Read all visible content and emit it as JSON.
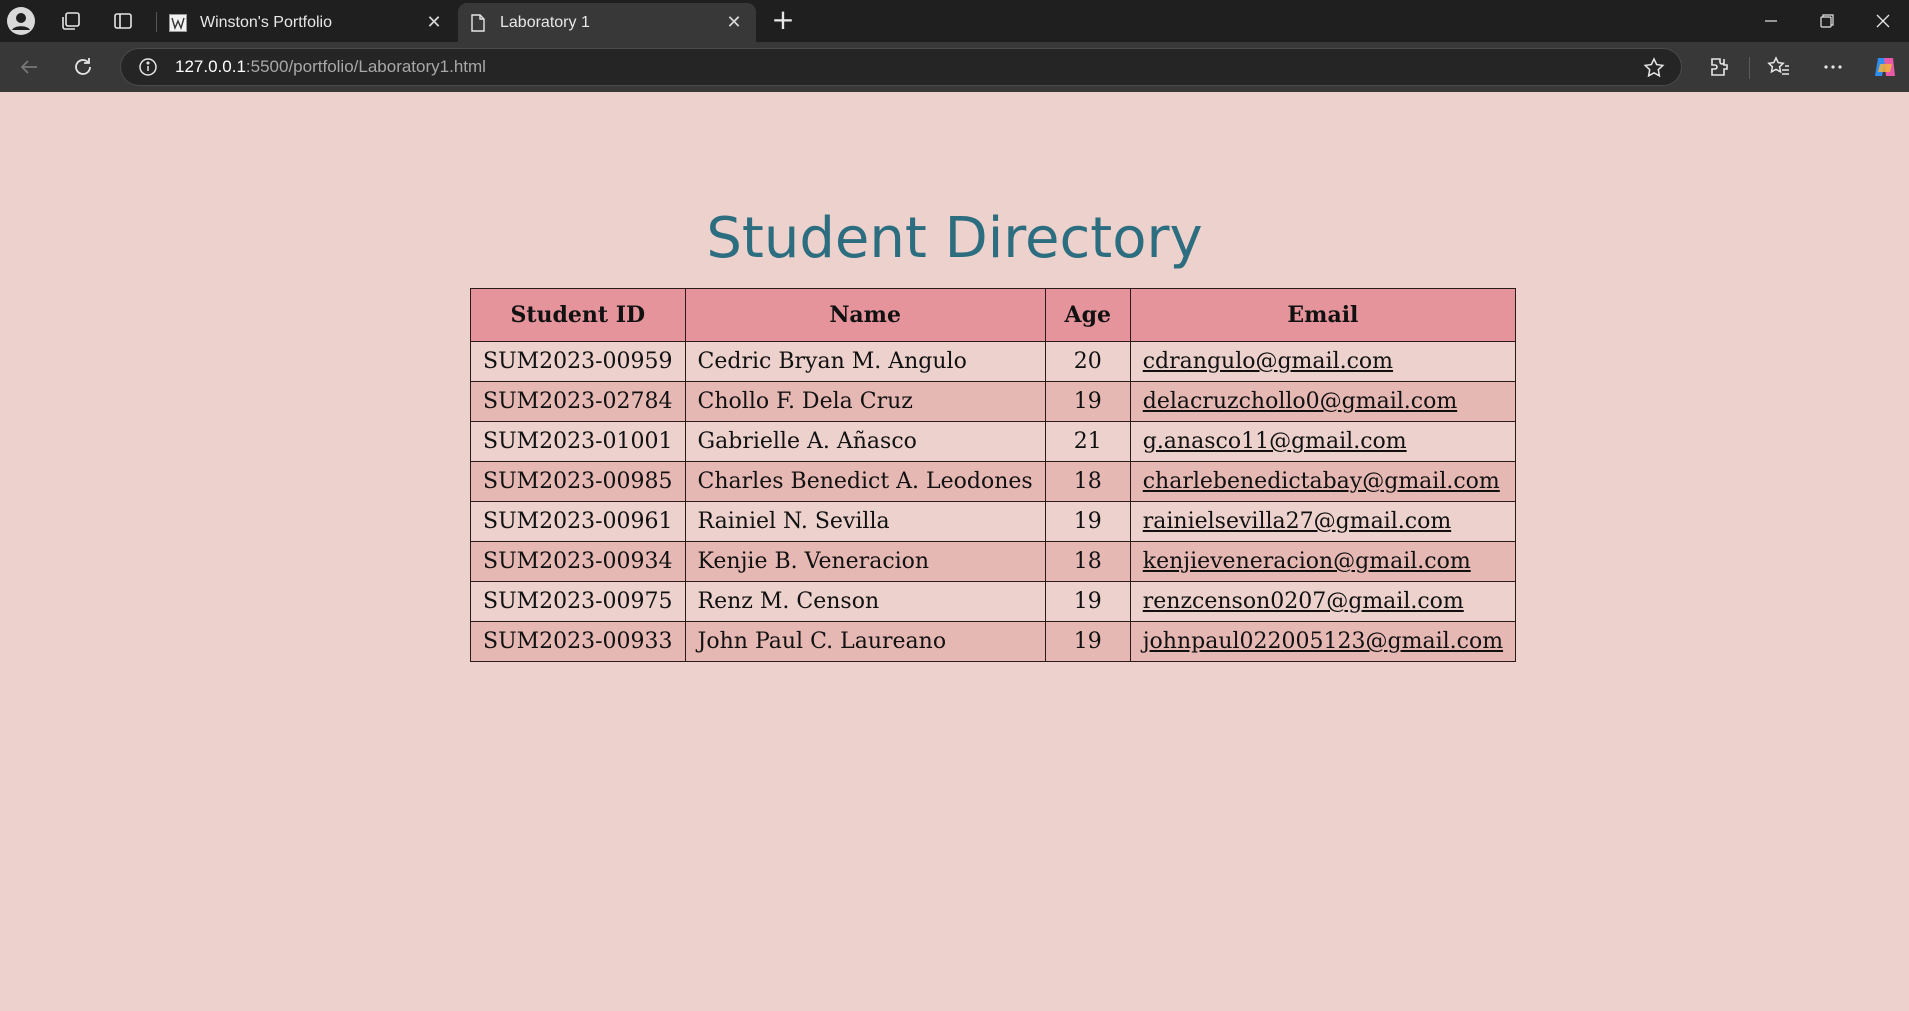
{
  "browser": {
    "tabs": [
      {
        "label": "Winston's Portfolio",
        "active": false
      },
      {
        "label": "Laboratory 1",
        "active": true
      }
    ],
    "address": {
      "host": "127.0.0.1",
      "path": ":5500/portfolio/Laboratory1.html"
    }
  },
  "page": {
    "title": "Student Directory",
    "colors": {
      "background": "#ecd1cd",
      "header_row": "#e6949c",
      "alt_row": "#e6b8b4",
      "title": "#2c6e80"
    },
    "table": {
      "headers": [
        "Student ID",
        "Name",
        "Age",
        "Email"
      ],
      "rows": [
        {
          "id": "SUM2023-00959",
          "name": "Cedric Bryan M. Angulo",
          "age": "20",
          "email": "cdrangulo@gmail.com"
        },
        {
          "id": "SUM2023-02784",
          "name": "Chollo F. Dela Cruz",
          "age": "19",
          "email": "delacruzchollo0@gmail.com"
        },
        {
          "id": "SUM2023-01001",
          "name": "Gabrielle A. Añasco",
          "age": "21",
          "email": "g.anasco11@gmail.com"
        },
        {
          "id": "SUM2023-00985",
          "name": "Charles Benedict A. Leodones",
          "age": "18",
          "email": "charlebenedictabay@gmail.com"
        },
        {
          "id": "SUM2023-00961",
          "name": "Rainiel N. Sevilla",
          "age": "19",
          "email": "rainielsevilla27@gmail.com"
        },
        {
          "id": "SUM2023-00934",
          "name": "Kenjie B. Veneracion",
          "age": "18",
          "email": "kenjieveneracion@gmail.com"
        },
        {
          "id": "SUM2023-00975",
          "name": "Renz M. Censon",
          "age": "19",
          "email": "renzcenson0207@gmail.com"
        },
        {
          "id": "SUM2023-00933",
          "name": "John Paul C. Laureano",
          "age": "19",
          "email": "johnpaul022005123@gmail.com"
        }
      ]
    }
  }
}
